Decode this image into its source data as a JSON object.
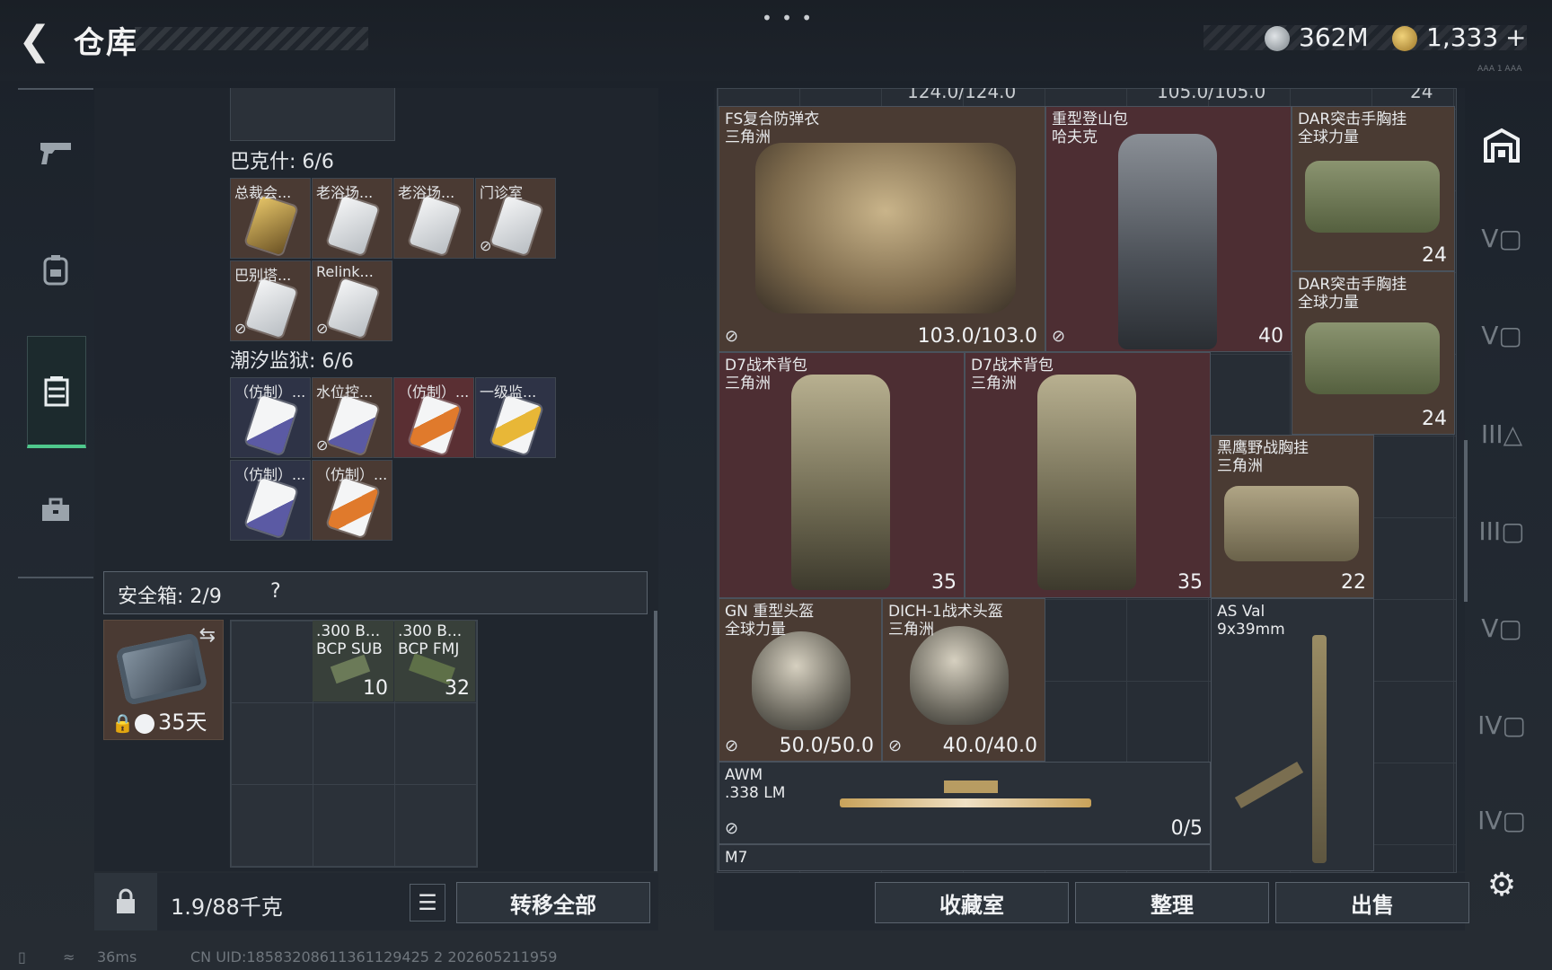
{
  "header": {
    "title": "仓库",
    "currency_silver": "362M",
    "currency_gold": "1,333",
    "plus": "+",
    "tiny": "AAA 1 AAA"
  },
  "nav_icons": [
    "pistol-icon",
    "backpack-icon",
    "locker-icon",
    "toolbox-icon"
  ],
  "left": {
    "section1": "巴克什: 6/6",
    "section1_cells": [
      {
        "label": "总裁会...",
        "bg": "brown",
        "card": "gold",
        "nolink": false
      },
      {
        "label": "老浴场...",
        "bg": "brown",
        "card": "white",
        "nolink": false
      },
      {
        "label": "老浴场...",
        "bg": "brown",
        "card": "white",
        "nolink": false
      },
      {
        "label": "门诊室",
        "bg": "brown",
        "card": "white",
        "nolink": true
      },
      {
        "label": "巴别塔...",
        "bg": "brown",
        "card": "white",
        "nolink": true
      },
      {
        "label": "Relink...",
        "bg": "brown",
        "card": "white",
        "nolink": true
      }
    ],
    "section2": "潮汐监狱: 6/6",
    "section2_cells": [
      {
        "label": "（仿制）...",
        "bg": "navy",
        "card": "purple",
        "nolink": false
      },
      {
        "label": "水位控...",
        "bg": "brown",
        "card": "purple",
        "nolink": true
      },
      {
        "label": "（仿制）...",
        "bg": "red",
        "card": "orange",
        "nolink": false
      },
      {
        "label": "一级监...",
        "bg": "navy",
        "card": "yellow",
        "nolink": false
      },
      {
        "label": "（仿制）...",
        "bg": "navy",
        "card": "purple",
        "nolink": false
      },
      {
        "label": "（仿制）...",
        "bg": "brown",
        "card": "orange",
        "nolink": false
      }
    ],
    "safebox_label": "安全箱: 2/9",
    "safebox_help": "?",
    "case_days": "35天",
    "ammo": [
      {
        "line1": ".300 B...",
        "line2": "BCP SUB",
        "count": "10"
      },
      {
        "line1": ".300 B...",
        "line2": "BCP FMJ",
        "count": "32"
      }
    ],
    "weight": "1.9/88千克",
    "transfer_all": "转移全部"
  },
  "right": {
    "top_partial": [
      "124.0/124.0",
      "105.0/105.0",
      "24"
    ],
    "items": [
      {
        "name": "FS复合防弹衣\n三角洲",
        "value": "103.0/103.0",
        "nolink": true
      },
      {
        "name": "重型登山包\n哈夫克",
        "value": "40",
        "nolink": true
      },
      {
        "name": "DAR突击手胸挂\n全球力量",
        "value": "24",
        "nolink": false
      },
      {
        "name": "DAR突击手胸挂\n全球力量",
        "value": "24",
        "nolink": false
      },
      {
        "name": "D7战术背包\n三角洲",
        "value": "35",
        "nolink": false
      },
      {
        "name": "D7战术背包\n三角洲",
        "value": "35",
        "nolink": false
      },
      {
        "name": "黑鹰野战胸挂\n三角洲",
        "value": "22",
        "nolink": false
      },
      {
        "name": "GN 重型头盔\n全球力量",
        "value": "50.0/50.0",
        "nolink": true
      },
      {
        "name": "DICH-1战术头盔\n三角洲",
        "value": "40.0/40.0",
        "nolink": true
      },
      {
        "name": "AS Val\n9x39mm",
        "value": "",
        "nolink": false
      },
      {
        "name": "AWM\n.338 LM",
        "value": "0/5",
        "nolink": true
      },
      {
        "name": "M7\n...",
        "value": "",
        "nolink": false
      }
    ],
    "buttons": [
      "收藏室",
      "整理",
      "出售"
    ]
  },
  "status": {
    "ping": "36ms",
    "uid": "CN UID:18583208611361129425 2 202605211959"
  }
}
